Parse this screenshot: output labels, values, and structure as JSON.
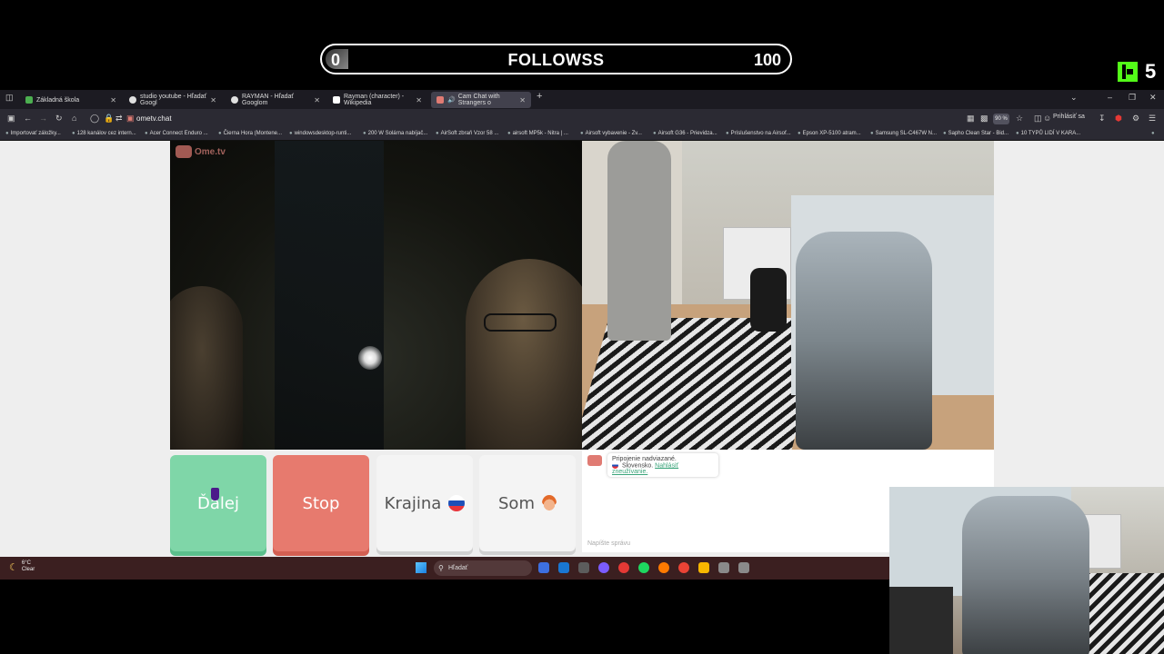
{
  "overlay": {
    "follow_goal": {
      "min": "0",
      "title": "FOLLOWSS",
      "max": "100",
      "progress": 0.05
    },
    "kick_count": "5"
  },
  "browser": {
    "tabs": [
      {
        "label": "Základná škola",
        "color": "#4caf50",
        "active": false
      },
      {
        "label": "studio youtube - Hľadať Googl",
        "color": "#e0e0e0",
        "active": false
      },
      {
        "label": "RAYMAN - Hľadať Googlom",
        "color": "#e0e0e0",
        "active": false
      },
      {
        "label": "Rayman (character) - Wikipedia",
        "color": "#ffffff",
        "active": false
      },
      {
        "label": "Cam Chat with Strangers o",
        "color": "#e07b73",
        "active": true
      }
    ],
    "url": "ometv.chat",
    "zoom": "90 %",
    "signin": "Prihlásiť sa",
    "bookmarks": [
      "Importovať záložky...",
      "128 kanálov cez intern...",
      "Acer Connect Enduro ...",
      "Čierna Hora (Montene...",
      "windowsdesktop-runti...",
      "200 W Solárna nabíjač...",
      "AirSoft zbraň Vzor 58 ...",
      "airsoft MP5k - Nitra | ...",
      "Airsoft vybavenie - Zv...",
      "Airsoft G36 - Prievidza...",
      "Príslušenstvo na Airsof...",
      "Epson XP-5100 atram...",
      "Samsung SL-C467W N...",
      "Sapho Clean Star - Bid...",
      "10 TYPŮ LIDÍ V KARA..."
    ]
  },
  "ometv": {
    "logo": "Ome.tv",
    "buttons": {
      "next": "Ďalej",
      "stop": "Stop",
      "country": "Krajina",
      "gender": "Som"
    },
    "chat": {
      "status": "Pripojenie nadviazané.",
      "country": "Slovensko.",
      "report": "Nahlásiť zneužívanie.",
      "input_placeholder": "Napíšte správu"
    }
  },
  "taskbar": {
    "weather_temp": "6°C",
    "weather_desc": "Clear",
    "search": "Hľadať",
    "apps": [
      "#3d6fe0",
      "#1976d2",
      "#5c5c5c",
      "#7b5cff",
      "#e53935",
      "#1ed760",
      "#ff7a00",
      "#ea4335",
      "#f9b700",
      "#8a8a8a",
      "#8a8a8a"
    ]
  }
}
